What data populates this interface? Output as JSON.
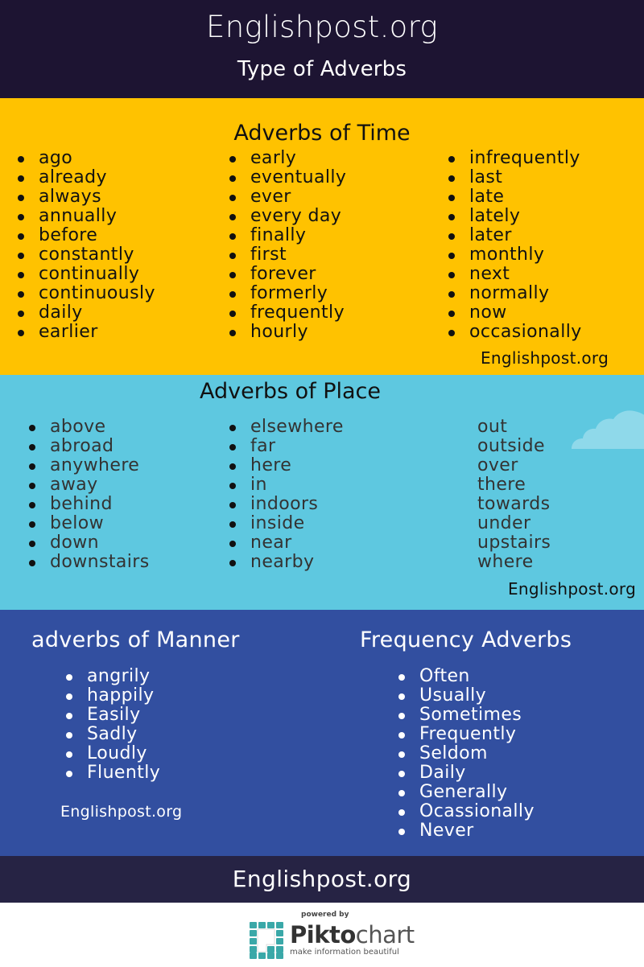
{
  "header": {
    "site": "Englishpost.org",
    "subtitle": "Type of Adverbs"
  },
  "colors": {
    "header_bg": "#1d1432",
    "time_bg": "#ffc200",
    "place_bg": "#5ec8e0",
    "manner_bg": "#324fa0",
    "footer_bg": "#262344",
    "cloud": "#8fd9ea",
    "piktochart_teal": "#3aa8a8"
  },
  "time": {
    "title": "Adverbs of Time",
    "columns": [
      [
        "ago",
        "already",
        "always",
        "annually",
        "before",
        "constantly",
        "continually",
        "continuously",
        "daily",
        "earlier"
      ],
      [
        "early",
        "eventually",
        "ever",
        "every day",
        "finally",
        "first",
        "forever",
        "formerly",
        "frequently",
        "hourly"
      ],
      [
        "infrequently",
        "last",
        "late",
        "lately",
        "later",
        "monthly",
        "next",
        "normally",
        "now",
        "occasionally"
      ]
    ],
    "credit": "Englishpost.org"
  },
  "place": {
    "title": "Adverbs of Place",
    "columns": [
      [
        "above",
        "abroad",
        "anywhere",
        "away",
        "behind",
        "below",
        "down",
        "downstairs"
      ],
      [
        "elsewhere",
        "far",
        "here",
        "in",
        "indoors",
        "inside",
        "near",
        "nearby"
      ],
      [
        "out",
        "outside",
        "over",
        "there",
        "towards",
        "under",
        "upstairs",
        "where"
      ]
    ],
    "credit": "Englishpost.org",
    "icon": "cloud-icon"
  },
  "manner": {
    "title": "adverbs of Manner",
    "items": [
      "angrily",
      "happily",
      "Easily",
      "Sadly",
      "Loudly",
      "Fluently"
    ],
    "credit": "Englishpost.org"
  },
  "frequency": {
    "title": "Frequency Adverbs",
    "items": [
      "Often",
      "Usually",
      "Sometimes",
      "Frequently",
      "Seldom",
      "Daily",
      "Generally",
      "Ocassionally",
      "Never"
    ]
  },
  "footer": {
    "site": "Englishpost.org"
  },
  "powered": {
    "label": "powered by",
    "brand_bold": "Pikto",
    "brand_light": "chart",
    "tagline": "make information beautiful",
    "icon": "piktochart-logo-icon"
  }
}
